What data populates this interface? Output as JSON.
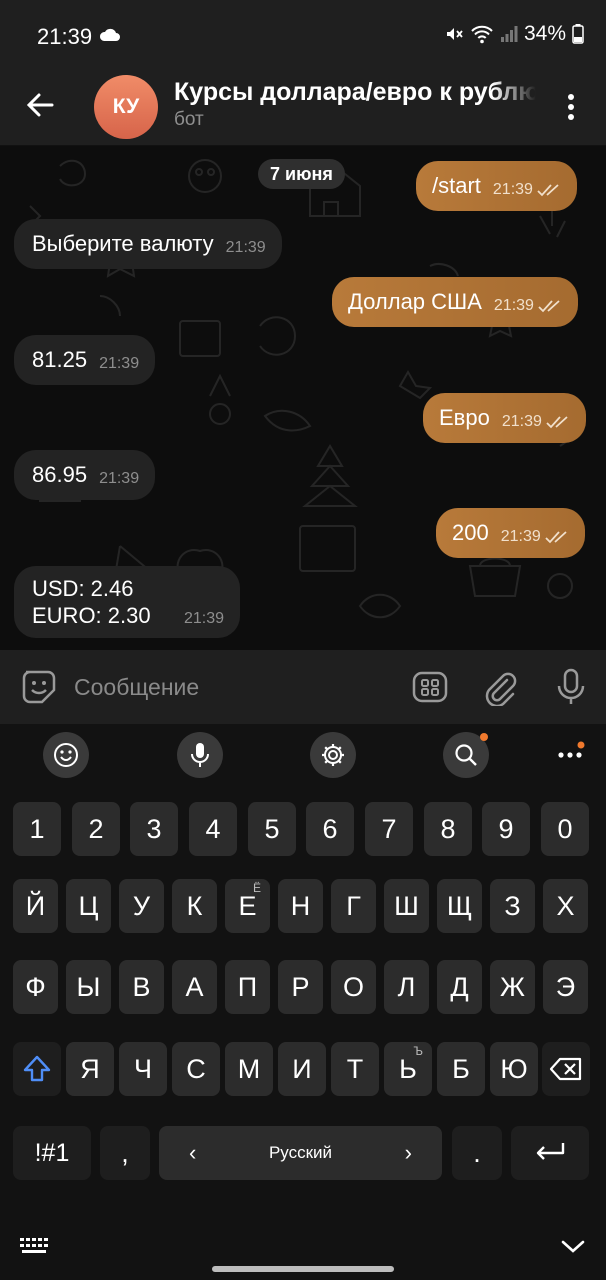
{
  "status": {
    "time": "21:39",
    "battery": "34%"
  },
  "header": {
    "avatar_initials": "КУ",
    "title": "Курсы доллара/евро к рублю",
    "subtitle": "бот"
  },
  "chat": {
    "date": "7 июня",
    "messages": [
      {
        "dir": "out",
        "text": "/start",
        "time": "21:39"
      },
      {
        "dir": "in",
        "text": "Выберите валюту",
        "time": "21:39"
      },
      {
        "dir": "out",
        "text": "Доллар США",
        "time": "21:39"
      },
      {
        "dir": "in",
        "text": "81.25",
        "time": "21:39"
      },
      {
        "dir": "out",
        "text": "Евро",
        "time": "21:39"
      },
      {
        "dir": "in",
        "text": "86.95",
        "time": "21:39"
      },
      {
        "dir": "out",
        "text": "200",
        "time": "21:39"
      },
      {
        "dir": "in",
        "lines": [
          "USD: 2.46",
          "EURO: 2.30"
        ],
        "time": "21:39"
      }
    ]
  },
  "input": {
    "placeholder": "Сообщение"
  },
  "keyboard": {
    "row_digits": [
      "1",
      "2",
      "3",
      "4",
      "5",
      "6",
      "7",
      "8",
      "9",
      "0"
    ],
    "row1": [
      "Й",
      "Ц",
      "У",
      "К",
      "Е",
      "Н",
      "Г",
      "Ш",
      "Щ",
      "З",
      "Х"
    ],
    "row1_sup": "Ё",
    "row2": [
      "Ф",
      "Ы",
      "В",
      "А",
      "П",
      "Р",
      "О",
      "Л",
      "Д",
      "Ж",
      "Э"
    ],
    "row3": [
      "Я",
      "Ч",
      "С",
      "М",
      "И",
      "Т",
      "Ь",
      "Б",
      "Ю"
    ],
    "row3_sup": "Ъ",
    "symbols_label": "!#1",
    "comma": ",",
    "space_label": "Русский",
    "period": "."
  },
  "colors": {
    "outgoing_bubble": "#b07236",
    "incoming_bubble": "#232323",
    "shift_accent": "#4f8ef7"
  }
}
